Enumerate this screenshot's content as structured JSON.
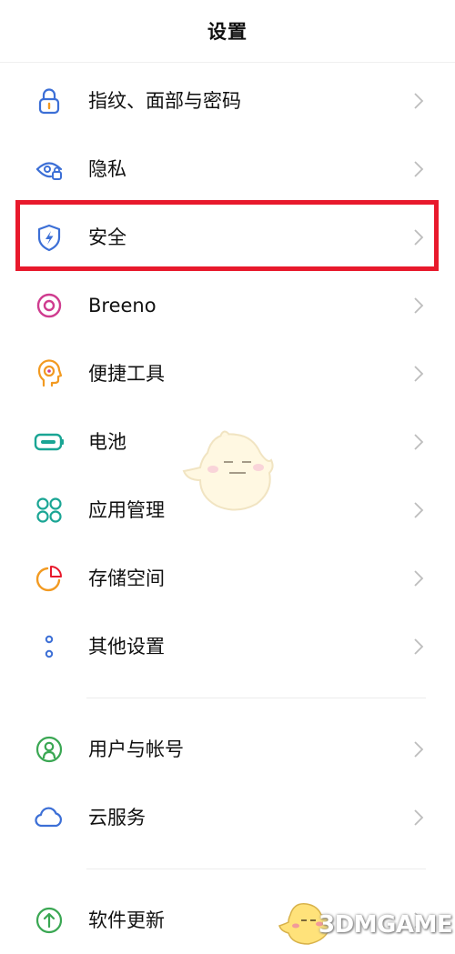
{
  "header": {
    "title": "设置"
  },
  "settings": {
    "items": [
      {
        "label": "指纹、面部与密码",
        "icon": "lock-icon",
        "color": "#3c6fd6"
      },
      {
        "label": "隐私",
        "icon": "privacy-eye-icon",
        "color": "#3c6fd6"
      },
      {
        "label": "安全",
        "icon": "security-shield-icon",
        "color": "#3c6fd6",
        "highlighted": true
      },
      {
        "label": "Breeno",
        "icon": "breeno-ring-icon",
        "color": "#cf3c8f"
      },
      {
        "label": "便捷工具",
        "icon": "convenience-head-icon",
        "color": "#f29a21"
      },
      {
        "label": "电池",
        "icon": "battery-icon",
        "color": "#1aa594"
      },
      {
        "label": "应用管理",
        "icon": "app-management-icon",
        "color": "#1aa594"
      },
      {
        "label": "存储空间",
        "icon": "storage-pie-icon",
        "color": "#f29a21"
      },
      {
        "label": "其他设置",
        "icon": "other-dots-icon",
        "color": "#3c6fd6"
      },
      {
        "label": "用户与帐号",
        "icon": "user-account-icon",
        "color": "#3aa753"
      },
      {
        "label": "云服务",
        "icon": "cloud-icon",
        "color": "#3c6fd6"
      },
      {
        "label": "软件更新",
        "icon": "software-update-icon",
        "color": "#3aa753"
      }
    ]
  },
  "watermark": {
    "text": "3DMGAME"
  },
  "colors": {
    "highlight_border": "#e8192c",
    "chevron": "#bdbdbd",
    "divider": "#ececec"
  }
}
